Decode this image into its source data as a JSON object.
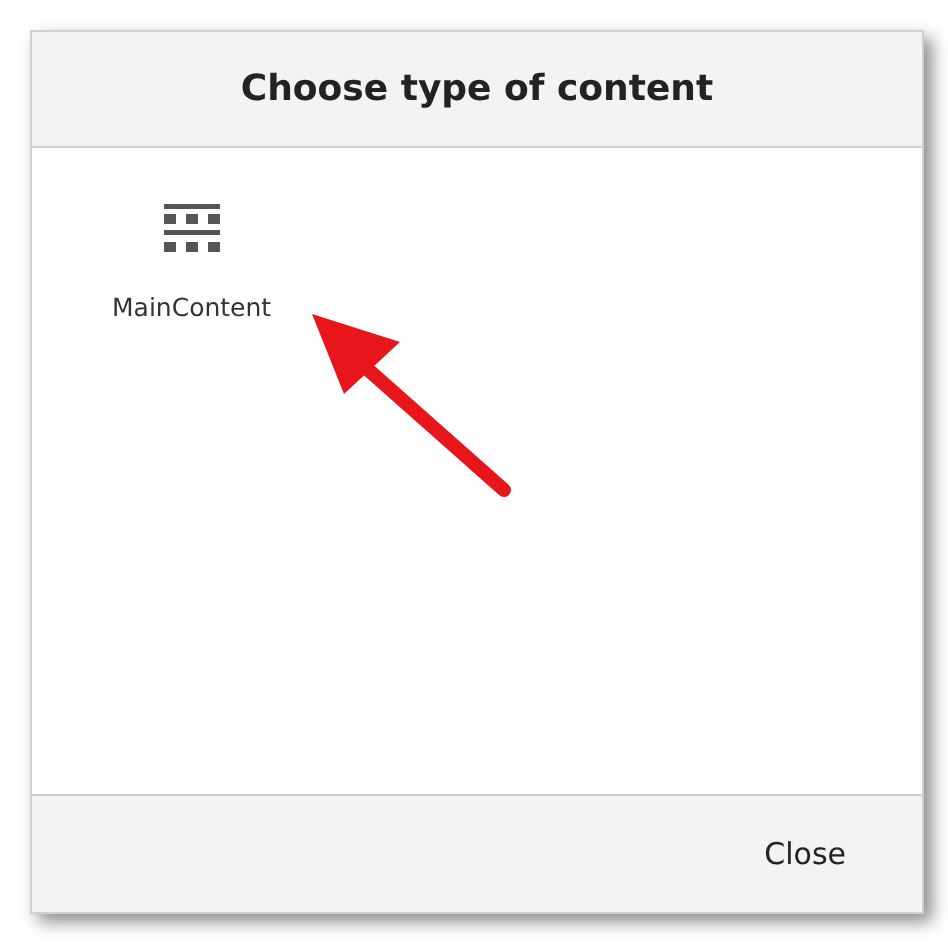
{
  "dialog": {
    "title": "Choose type of content",
    "items": [
      {
        "label": "MainContent"
      }
    ],
    "buttons": [
      "Close"
    ]
  }
}
